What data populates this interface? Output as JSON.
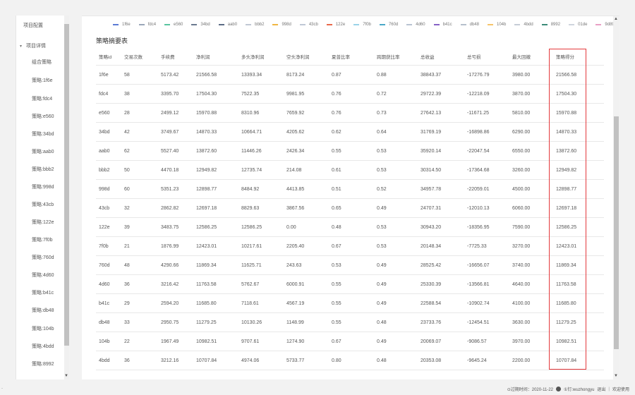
{
  "sidebar": {
    "items": [
      {
        "label": "项目配置",
        "kind": "top"
      },
      {
        "label": "项目详情",
        "kind": "group",
        "caret": "▾"
      },
      {
        "label": "组合策略",
        "kind": "sub"
      },
      {
        "label": "策略:1f6e",
        "kind": "sub"
      },
      {
        "label": "策略:fdc4",
        "kind": "sub"
      },
      {
        "label": "策略:e560",
        "kind": "sub"
      },
      {
        "label": "策略:34bd",
        "kind": "sub"
      },
      {
        "label": "策略:aab0",
        "kind": "sub"
      },
      {
        "label": "策略:bbb2",
        "kind": "sub"
      },
      {
        "label": "策略:998d",
        "kind": "sub"
      },
      {
        "label": "策略:43cb",
        "kind": "sub"
      },
      {
        "label": "策略:122e",
        "kind": "sub"
      },
      {
        "label": "策略:7f0b",
        "kind": "sub"
      },
      {
        "label": "策略:760d",
        "kind": "sub"
      },
      {
        "label": "策略:4d60",
        "kind": "sub"
      },
      {
        "label": "策略:b41c",
        "kind": "sub"
      },
      {
        "label": "策略:db48",
        "kind": "sub"
      },
      {
        "label": "策略:104b",
        "kind": "sub"
      },
      {
        "label": "策略:4bdd",
        "kind": "sub"
      },
      {
        "label": "策略:8992",
        "kind": "sub"
      }
    ]
  },
  "legend": [
    {
      "label": "1f6e",
      "color": "#5b7bd5"
    },
    {
      "label": "fdc4",
      "color": "#9aa7b8"
    },
    {
      "label": "e560",
      "color": "#59c4a0"
    },
    {
      "label": "34bd",
      "color": "#6b7a8f"
    },
    {
      "label": "aab0",
      "color": "#5a6b84"
    },
    {
      "label": "bbb2",
      "color": "#c0c8d4"
    },
    {
      "label": "998d",
      "color": "#f0b642"
    },
    {
      "label": "43cb",
      "color": "#bfc8d6"
    },
    {
      "label": "122e",
      "color": "#e8684a"
    },
    {
      "label": "7f0b",
      "color": "#9ad3e8"
    },
    {
      "label": "760d",
      "color": "#4aa8c8"
    },
    {
      "label": "4d60",
      "color": "#b8c3d2"
    },
    {
      "label": "b41c",
      "color": "#8561c5"
    },
    {
      "label": "db48",
      "color": "#b5bfcc"
    },
    {
      "label": "104b",
      "color": "#f6c46a"
    },
    {
      "label": "4bdd",
      "color": "#c5ccd6"
    },
    {
      "label": "8992",
      "color": "#3b8a78"
    },
    {
      "label": "01de",
      "color": "#cfd5de"
    },
    {
      "label": "9d89",
      "color": "#e9a0c5"
    },
    {
      "label": "0656",
      "color": "#d3d8e0"
    }
  ],
  "table": {
    "title": "策略摘要表",
    "headers": [
      "策略id",
      "交易次数",
      "手续费",
      "净利润",
      "多头净利润",
      "空头净利润",
      "夏普比率",
      "跨期获比率",
      "总收益",
      "总亏损",
      "最大回撤",
      "策略得分"
    ],
    "rows": [
      [
        "1f6e",
        "58",
        "5173.42",
        "21566.58",
        "13393.34",
        "8173.24",
        "0.87",
        "0.88",
        "38843.37",
        "-17276.79",
        "3980.00",
        "21566.58"
      ],
      [
        "fdc4",
        "38",
        "3395.70",
        "17504.30",
        "7522.35",
        "9981.95",
        "0.76",
        "0.72",
        "29722.39",
        "-12218.09",
        "3870.00",
        "17504.30"
      ],
      [
        "e560",
        "28",
        "2499.12",
        "15970.88",
        "8310.96",
        "7659.92",
        "0.76",
        "0.73",
        "27642.13",
        "-11671.25",
        "5810.00",
        "15970.88"
      ],
      [
        "34bd",
        "42",
        "3749.67",
        "14870.33",
        "10664.71",
        "4205.62",
        "0.62",
        "0.64",
        "31769.19",
        "-16898.86",
        "6290.00",
        "14870.33"
      ],
      [
        "aab0",
        "62",
        "5527.40",
        "13872.60",
        "11446.26",
        "2426.34",
        "0.55",
        "0.53",
        "35920.14",
        "-22047.54",
        "6550.00",
        "13872.60"
      ],
      [
        "bbb2",
        "50",
        "4470.18",
        "12949.82",
        "12735.74",
        "214.08",
        "0.61",
        "0.53",
        "30314.50",
        "-17364.68",
        "3260.00",
        "12949.82"
      ],
      [
        "998d",
        "60",
        "5351.23",
        "12898.77",
        "8484.92",
        "4413.85",
        "0.51",
        "0.52",
        "34957.78",
        "-22059.01",
        "4500.00",
        "12898.77"
      ],
      [
        "43cb",
        "32",
        "2862.82",
        "12697.18",
        "8829.63",
        "3867.56",
        "0.65",
        "0.49",
        "24707.31",
        "-12010.13",
        "6060.00",
        "12697.18"
      ],
      [
        "122e",
        "39",
        "3483.75",
        "12586.25",
        "12586.25",
        "0.00",
        "0.48",
        "0.53",
        "30943.20",
        "-18356.95",
        "7590.00",
        "12586.25"
      ],
      [
        "7f0b",
        "21",
        "1876.99",
        "12423.01",
        "10217.61",
        "2205.40",
        "0.67",
        "0.53",
        "20148.34",
        "-7725.33",
        "3270.00",
        "12423.01"
      ],
      [
        "760d",
        "48",
        "4290.66",
        "11869.34",
        "11625.71",
        "243.63",
        "0.53",
        "0.49",
        "28525.42",
        "-16656.07",
        "3740.00",
        "11869.34"
      ],
      [
        "4d60",
        "36",
        "3216.42",
        "11763.58",
        "5762.67",
        "6000.91",
        "0.55",
        "0.49",
        "25330.39",
        "-13566.81",
        "4640.00",
        "11763.58"
      ],
      [
        "b41c",
        "29",
        "2594.20",
        "11685.80",
        "7118.61",
        "4567.19",
        "0.55",
        "0.49",
        "22588.54",
        "-10902.74",
        "4100.00",
        "11685.80"
      ],
      [
        "db48",
        "33",
        "2950.75",
        "11279.25",
        "10130.26",
        "1148.99",
        "0.55",
        "0.48",
        "23733.76",
        "-12454.51",
        "3630.00",
        "11279.25"
      ],
      [
        "104b",
        "22",
        "1967.49",
        "10982.51",
        "9707.61",
        "1274.90",
        "0.67",
        "0.49",
        "20069.07",
        "-9086.57",
        "3970.00",
        "10982.51"
      ],
      [
        "4bdd",
        "36",
        "3212.16",
        "10707.84",
        "4974.06",
        "5733.77",
        "0.80",
        "0.48",
        "20353.08",
        "-9645.24",
        "2200.00",
        "10707.84"
      ]
    ]
  },
  "footer": {
    "expire": "⊙过期时间：2020-11-22",
    "user": "①钉:wuzhongyu",
    "logout": "退出",
    "sep": "|",
    "welcome": "欢迎使用"
  },
  "left_dash": "-"
}
